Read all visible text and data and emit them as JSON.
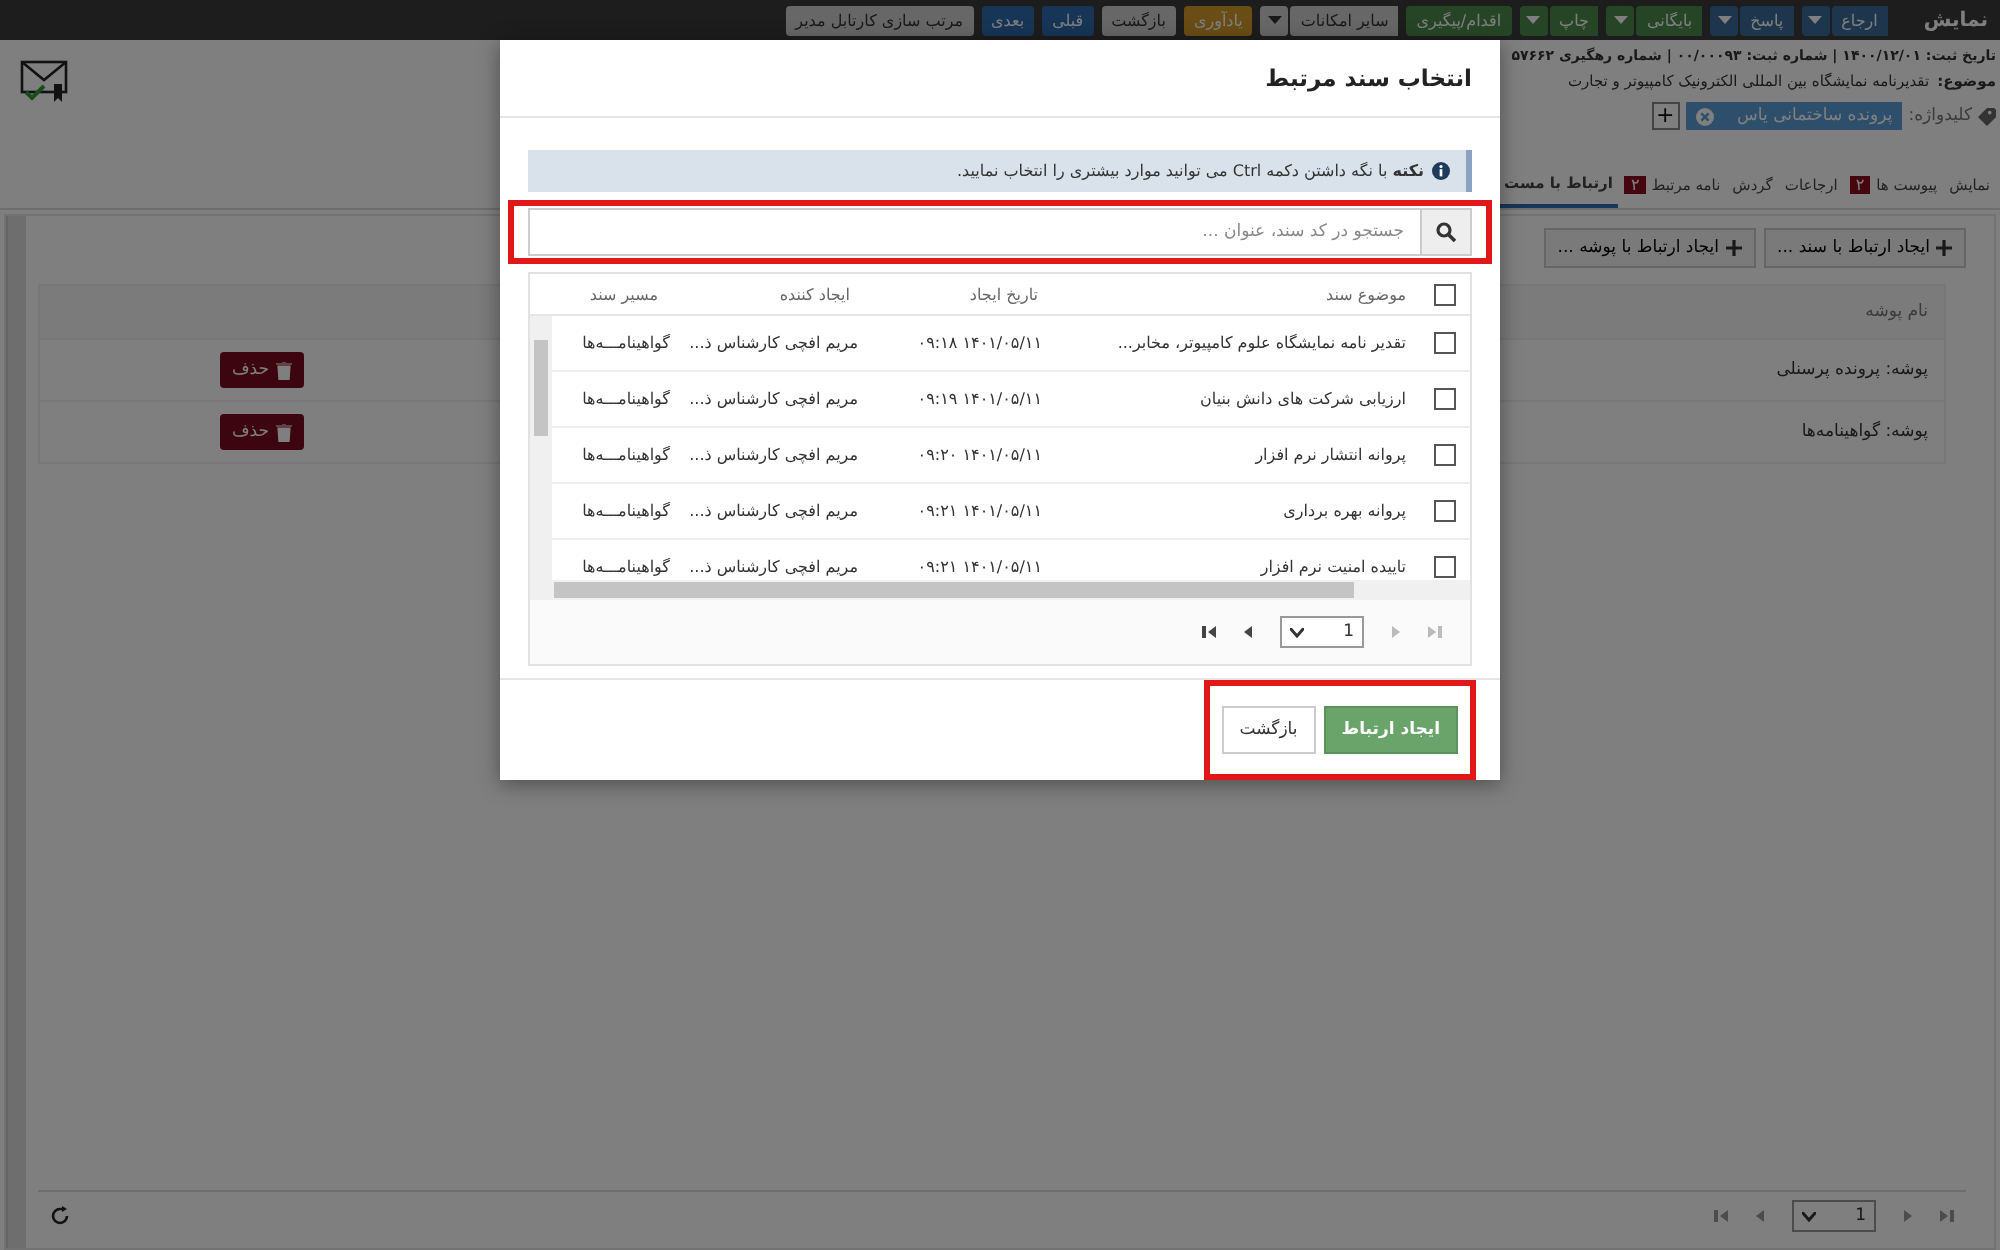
{
  "toolbar": {
    "title": "نمایش",
    "buttons": [
      {
        "label": "ارجاع",
        "kind": "info",
        "dropdown": true
      },
      {
        "label": "پاسخ",
        "kind": "info",
        "dropdown": true
      },
      {
        "label": "بایگانی",
        "kind": "success",
        "dropdown": true
      },
      {
        "label": "چاپ",
        "kind": "success",
        "dropdown": true
      },
      {
        "label": "اقدام/پیگیری",
        "kind": "success",
        "dropdown": false
      },
      {
        "label": "سایر امکانات",
        "kind": "default",
        "dropdown": true
      },
      {
        "label": "یادآوری",
        "kind": "warning",
        "dropdown": false
      },
      {
        "label": "بازگشت",
        "kind": "default",
        "dropdown": false
      },
      {
        "label": "قبلی",
        "kind": "primary",
        "dropdown": false
      },
      {
        "label": "بعدی",
        "kind": "primary",
        "dropdown": false
      },
      {
        "label": "مرتب سازی کارتابل مدیر",
        "kind": "default",
        "dropdown": false
      }
    ]
  },
  "record": {
    "info": "تاریخ ثبت: ۱۴۰۰/۱۲/۰۱ | شماره ثبت: ۰۰/۰۰۰۹۳ | شماره رهگیری ۵۷۶۶۲",
    "subject_label": "موضوع:",
    "subject": "تقدیرنامه نمایشگاه بین المللی الکترونیک کامپیوتر و تجارت"
  },
  "keywords": {
    "label": "کلیدواژه:",
    "tags": [
      "پرونده ساختمانی یاس"
    ],
    "add_label": "+"
  },
  "tabs": [
    {
      "label": "نمایش",
      "selected": false
    },
    {
      "label": "پیوست ها",
      "badge": "۲",
      "selected": false
    },
    {
      "label": "ارجاعات",
      "selected": false
    },
    {
      "label": "گردش",
      "selected": false
    },
    {
      "label": "نامه مرتبط",
      "badge": "۲",
      "selected": false
    },
    {
      "label": "ارتباط با مست",
      "selected": true
    }
  ],
  "actions": [
    "ایجاد ارتباط با سند ...",
    "ایجاد ارتباط با پوشه ..."
  ],
  "folders": {
    "header": "نام پوشه",
    "rows": [
      {
        "name": "پوشه: پرونده پرسنلی",
        "action": "حذف"
      },
      {
        "name": "پوشه: گواهینامه‌ها",
        "action": "حذف"
      }
    ]
  },
  "pager": {
    "page": "1"
  },
  "dialog": {
    "title": "انتخاب سند مرتبط",
    "note": "**نکته** با نگه داشتن دکمه Ctrl می توانید موارد بیشتری را انتخاب نمایید.",
    "search_placeholder": "جستجو در کد سند، عنوان ...",
    "columns": [
      "موضوع سند",
      "تاریخ ایجاد",
      "ایجاد کننده",
      "مسیر سند"
    ],
    "select_all": {
      "checked": false
    },
    "rows": [
      {
        "subject": "تقدیر نامه نمایشگاه علوم کامپیوتر، مخابر...",
        "created": "۱۴۰۱/۰۵/۱۱ ۰۹:۱۸",
        "creator": "مریم افچی کارشناس ذ...",
        "path": "گواهینامـــه‌ها",
        "checked": false
      },
      {
        "subject": "ارزیابی شرکت های دانش بنیان",
        "created": "۱۴۰۱/۰۵/۱۱ ۰۹:۱۹",
        "creator": "مریم افچی کارشناس ذ...",
        "path": "گواهینامـــه‌ها",
        "checked": false
      },
      {
        "subject": "پروانه انتشار نرم افزار",
        "created": "۱۴۰۱/۰۵/۱۱ ۰۹:۲۰",
        "creator": "مریم افچی کارشناس ذ...",
        "path": "گواهینامـــه‌ها",
        "checked": false
      },
      {
        "subject": "پروانه بهره برداری",
        "created": "۱۴۰۱/۰۵/۱۱ ۰۹:۲۱",
        "creator": "مریم افچی کارشناس ذ...",
        "path": "گواهینامـــه‌ها",
        "checked": false
      },
      {
        "subject": "تاییده امنیت نرم افزار",
        "created": "۱۴۰۱/۰۵/۱۱ ۰۹:۲۱",
        "creator": "مریم افچی کارشناس ذ...",
        "path": "گواهینامـــه‌ها",
        "checked": false
      }
    ],
    "page": "1",
    "buttons": [
      {
        "label": "ایجاد ارتباط",
        "kind": "primary"
      },
      {
        "label": "بازگشت",
        "kind": "default"
      }
    ]
  }
}
